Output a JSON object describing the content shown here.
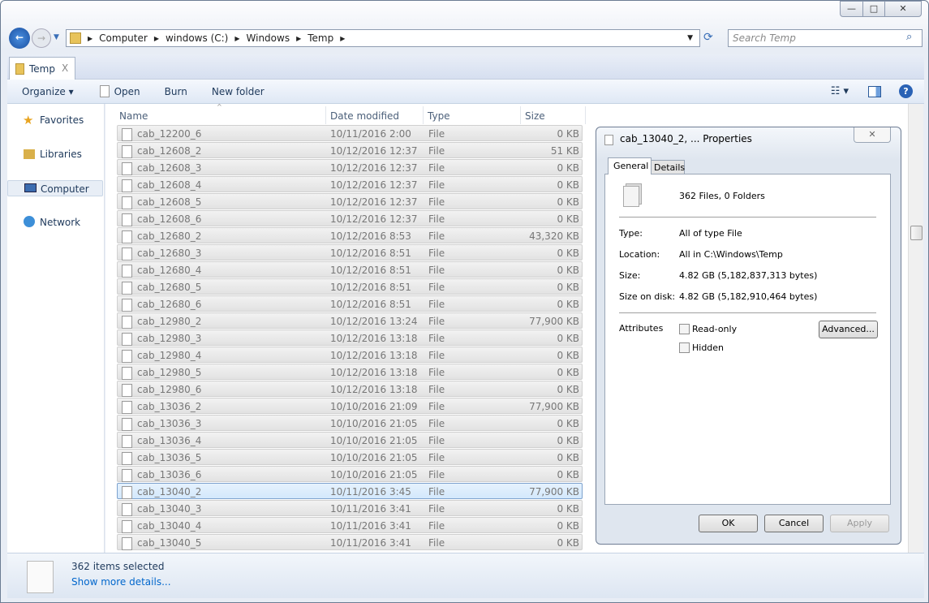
{
  "window": {
    "minimize": "—",
    "maximize": "□",
    "close": "✕"
  },
  "address": {
    "crumbs": [
      "Computer",
      "windows (C:)",
      "Windows",
      "Temp"
    ]
  },
  "search": {
    "placeholder": "Search Temp"
  },
  "tab": {
    "label": "Temp",
    "close": "X"
  },
  "toolbar": {
    "organize": "Organize ▾",
    "open": "Open",
    "burn": "Burn",
    "new_folder": "New folder"
  },
  "nav": {
    "items": [
      "Favorites",
      "Libraries",
      "Computer",
      "Network"
    ]
  },
  "columns": [
    "Name",
    "Date modified",
    "Type",
    "Size"
  ],
  "rows": [
    [
      "cab_12200_6",
      "10/11/2016 2:00",
      "File",
      "0 KB"
    ],
    [
      "cab_12608_2",
      "10/12/2016 12:37",
      "File",
      "51 KB"
    ],
    [
      "cab_12608_3",
      "10/12/2016 12:37",
      "File",
      "0 KB"
    ],
    [
      "cab_12608_4",
      "10/12/2016 12:37",
      "File",
      "0 KB"
    ],
    [
      "cab_12608_5",
      "10/12/2016 12:37",
      "File",
      "0 KB"
    ],
    [
      "cab_12608_6",
      "10/12/2016 12:37",
      "File",
      "0 KB"
    ],
    [
      "cab_12680_2",
      "10/12/2016 8:53",
      "File",
      "43,320 KB"
    ],
    [
      "cab_12680_3",
      "10/12/2016 8:51",
      "File",
      "0 KB"
    ],
    [
      "cab_12680_4",
      "10/12/2016 8:51",
      "File",
      "0 KB"
    ],
    [
      "cab_12680_5",
      "10/12/2016 8:51",
      "File",
      "0 KB"
    ],
    [
      "cab_12680_6",
      "10/12/2016 8:51",
      "File",
      "0 KB"
    ],
    [
      "cab_12980_2",
      "10/12/2016 13:24",
      "File",
      "77,900 KB"
    ],
    [
      "cab_12980_3",
      "10/12/2016 13:18",
      "File",
      "0 KB"
    ],
    [
      "cab_12980_4",
      "10/12/2016 13:18",
      "File",
      "0 KB"
    ],
    [
      "cab_12980_5",
      "10/12/2016 13:18",
      "File",
      "0 KB"
    ],
    [
      "cab_12980_6",
      "10/12/2016 13:18",
      "File",
      "0 KB"
    ],
    [
      "cab_13036_2",
      "10/10/2016 21:09",
      "File",
      "77,900 KB"
    ],
    [
      "cab_13036_3",
      "10/10/2016 21:05",
      "File",
      "0 KB"
    ],
    [
      "cab_13036_4",
      "10/10/2016 21:05",
      "File",
      "0 KB"
    ],
    [
      "cab_13036_5",
      "10/10/2016 21:05",
      "File",
      "0 KB"
    ],
    [
      "cab_13036_6",
      "10/10/2016 21:05",
      "File",
      "0 KB"
    ],
    [
      "cab_13040_2",
      "10/11/2016 3:45",
      "File",
      "77,900 KB"
    ],
    [
      "cab_13040_3",
      "10/11/2016 3:41",
      "File",
      "0 KB"
    ],
    [
      "cab_13040_4",
      "10/11/2016 3:41",
      "File",
      "0 KB"
    ],
    [
      "cab_13040_5",
      "10/11/2016 3:41",
      "File",
      "0 KB"
    ]
  ],
  "selected_row": "cab_13040_2",
  "details": {
    "count": "362 items selected",
    "more": "Show more details..."
  },
  "dialog": {
    "title": "cab_13040_2, ... Properties",
    "tabs": [
      "General",
      "Details"
    ],
    "summary": "362 Files, 0 Folders",
    "type_label": "Type:",
    "type_value": "All of type File",
    "location_label": "Location:",
    "location_value": "All in C:\\Windows\\Temp",
    "size_label": "Size:",
    "size_value": "4.82 GB (5,182,837,313 bytes)",
    "disk_label": "Size on disk:",
    "disk_value": "4.82 GB (5,182,910,464 bytes)",
    "attributes_label": "Attributes",
    "readonly": "Read-only",
    "hidden": "Hidden",
    "advanced": "Advanced...",
    "ok": "OK",
    "cancel": "Cancel",
    "apply": "Apply"
  }
}
